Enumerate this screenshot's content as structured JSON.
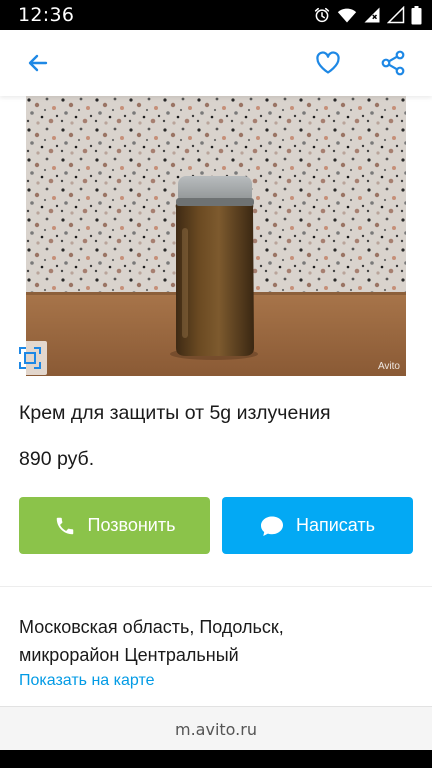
{
  "status_bar": {
    "time": "12:36",
    "icons": [
      "alarm-icon",
      "wifi-icon",
      "signal-icon",
      "battery-icon"
    ]
  },
  "app_bar": {
    "back_icon": "arrow-left-icon",
    "favorite_icon": "heart-outline-icon",
    "share_icon": "share-icon",
    "accent_color": "#1e88e5"
  },
  "photo": {
    "watermark": "Avito",
    "gallery_icon": "fullscreen-icon"
  },
  "listing": {
    "title": "Крем для защиты от 5g излучения",
    "price": "890 руб."
  },
  "actions": {
    "call_label": "Позвонить",
    "call_icon": "phone-icon",
    "call_color": "#8bc34a",
    "write_label": "Написать",
    "write_icon": "chat-bubble-icon",
    "write_color": "#03a9f4"
  },
  "location": {
    "address_line1": "Московская область, Подольск,",
    "address_line2": "микрорайон Центральный",
    "map_link": "Показать на карте"
  },
  "browser": {
    "url": "m.avito.ru"
  }
}
